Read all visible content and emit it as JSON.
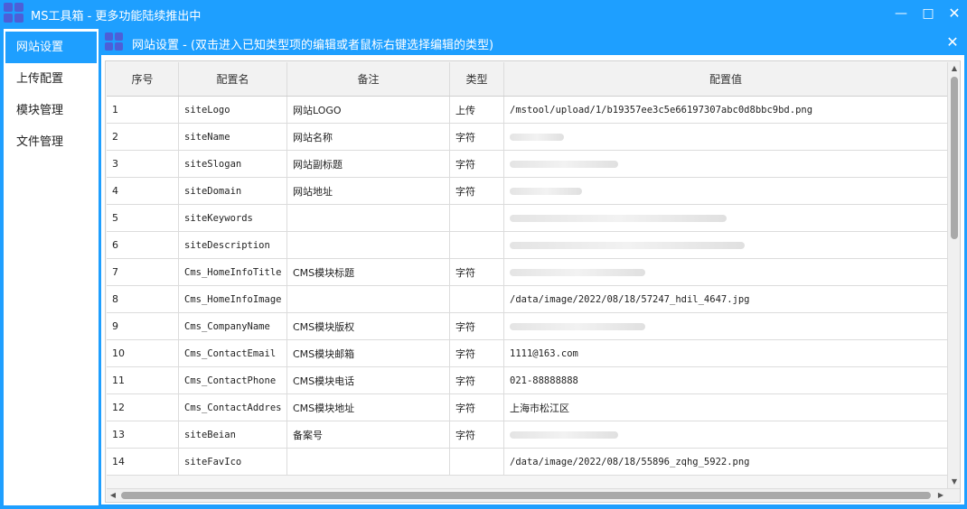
{
  "window": {
    "title": "MS工具箱 - 更多功能陆续推出中",
    "min_icon": "minimize-icon",
    "max_icon": "maximize-icon",
    "close_icon": "close-icon"
  },
  "sidebar": {
    "items": [
      {
        "label": "网站设置",
        "active": true
      },
      {
        "label": "上传配置",
        "active": false
      },
      {
        "label": "模块管理",
        "active": false
      },
      {
        "label": "文件管理",
        "active": false
      }
    ]
  },
  "panel": {
    "title": "网站设置 - (双击进入已知类型项的编辑或者鼠标右键选择编辑的类型)",
    "close_icon": "close-icon"
  },
  "table": {
    "columns": [
      "序号",
      "配置名",
      "备注",
      "类型",
      "配置值"
    ],
    "rows": [
      {
        "id": "1",
        "name": "siteLogo",
        "note": "网站LOGO",
        "type": "上传",
        "value": "/mstool/upload/1/b19357ee3c5e66197307abc0d8bbc9bd.png"
      },
      {
        "id": "2",
        "name": "siteName",
        "note": "网站名称",
        "type": "字符",
        "value": ""
      },
      {
        "id": "3",
        "name": "siteSlogan",
        "note": "网站副标题",
        "type": "字符",
        "value": ""
      },
      {
        "id": "4",
        "name": "siteDomain",
        "note": "网站地址",
        "type": "字符",
        "value": ""
      },
      {
        "id": "5",
        "name": "siteKeywords",
        "note": "",
        "type": "",
        "value": ""
      },
      {
        "id": "6",
        "name": "siteDescription",
        "note": "",
        "type": "",
        "value": ""
      },
      {
        "id": "7",
        "name": "Cms_HomeInfoTitle",
        "note": "CMS模块标题",
        "type": "字符",
        "value": ""
      },
      {
        "id": "8",
        "name": "Cms_HomeInfoImage",
        "note": "",
        "type": "",
        "value": "/data/image/2022/08/18/57247_hdil_4647.jpg"
      },
      {
        "id": "9",
        "name": "Cms_CompanyName",
        "note": "CMS模块版权",
        "type": "字符",
        "value": ""
      },
      {
        "id": "10",
        "name": "Cms_ContactEmail",
        "note": "CMS模块邮箱",
        "type": "字符",
        "value": "1111@163.com"
      },
      {
        "id": "11",
        "name": "Cms_ContactPhone",
        "note": "CMS模块电话",
        "type": "字符",
        "value": "021-88888888"
      },
      {
        "id": "12",
        "name": "Cms_ContactAddres",
        "note": "CMS模块地址",
        "type": "字符",
        "value": "上海市松江区"
      },
      {
        "id": "13",
        "name": "siteBeian",
        "note": "备案号",
        "type": "字符",
        "value": ""
      },
      {
        "id": "14",
        "name": "siteFavIco",
        "note": "",
        "type": "",
        "value": "/data/image/2022/08/18/55896_zqhg_5922.png"
      }
    ]
  }
}
